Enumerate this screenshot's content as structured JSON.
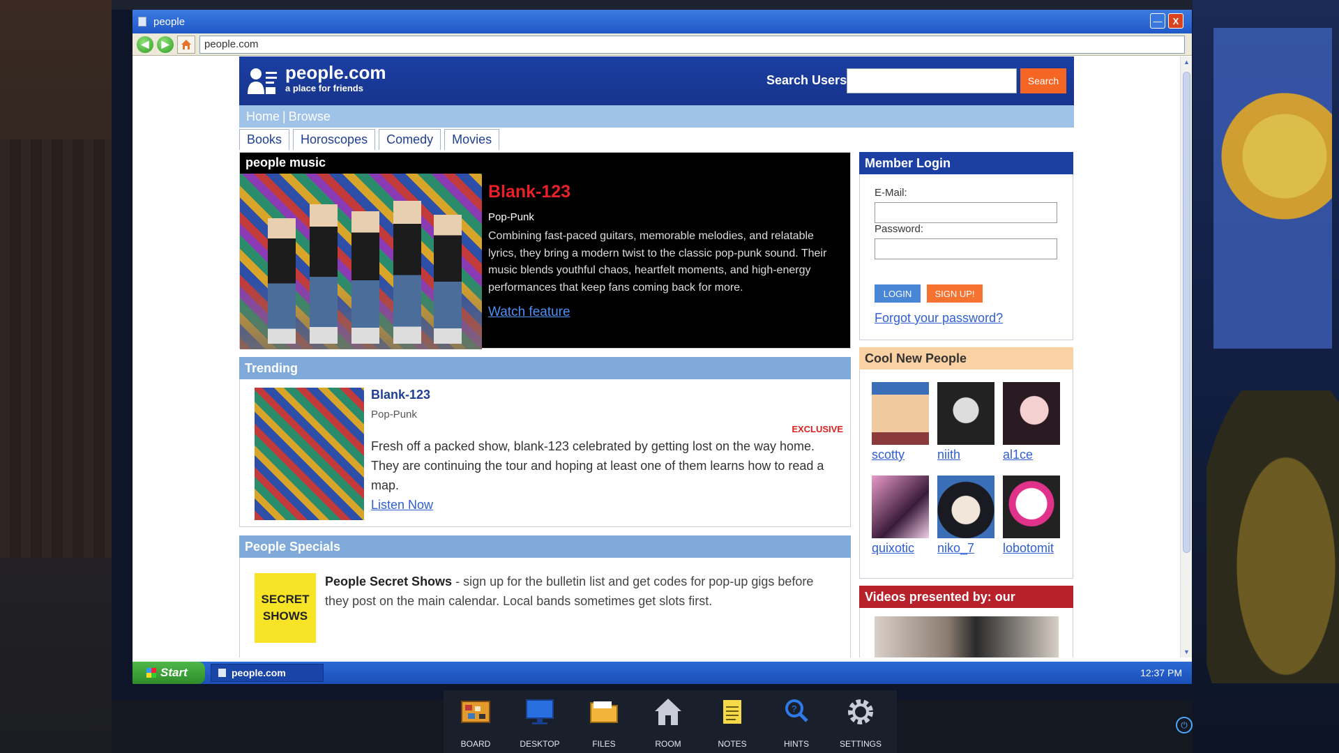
{
  "window": {
    "title": "people",
    "min_label": "—",
    "close_label": "X"
  },
  "address": {
    "url": "people.com",
    "back": "◀",
    "forward": "▶"
  },
  "site": {
    "logo_title": "people.com",
    "logo_sub": "a place for friends",
    "search_label": "Search Users:",
    "search_value": "",
    "search_button": "Search",
    "nav": {
      "home": "Home",
      "sep": "|",
      "browse": "Browse"
    },
    "tabs": [
      "Books",
      "Horoscopes",
      "Comedy",
      "Movies"
    ],
    "feature": {
      "section_title": "people music",
      "band": "Blank-123",
      "genre": "Pop-Punk",
      "description": "Combining fast-paced guitars, memorable melodies, and relatable lyrics, they bring a modern twist to the classic pop-punk sound. Their music blends youthful chaos, heartfelt moments, and high-energy performances that keep fans coming back for more.",
      "link": "Watch feature"
    },
    "trending": {
      "title": "Trending",
      "band": "Blank-123",
      "genre": "Pop-Punk",
      "badge": "EXCLUSIVE",
      "text": "Fresh off a packed show, blank-123 celebrated by getting lost on the way home. They are continuing the tour and hoping at least one of them learns how to read a map.",
      "link": "Listen Now"
    },
    "specials": {
      "title": "People Specials",
      "badge": "SECRET SHOWS",
      "headline": "People Secret Shows",
      "text": " - sign up for the bulletin list and get codes for pop-up gigs before they post on the main calendar. Local bands sometimes get slots first."
    },
    "login": {
      "title": "Member Login",
      "email_label": "E-Mail:",
      "password_label": "Password:",
      "login_button": "LOGIN",
      "signup_button": "SIGN UP!",
      "forgot": "Forgot your password?"
    },
    "cool_people": {
      "title": "Cool New People",
      "people": [
        "scotty",
        "niith",
        "al1ce",
        "quixotic",
        "niko_7",
        "lobotomit"
      ]
    },
    "videos": {
      "title": "Videos presented by: our sponsors"
    }
  },
  "taskbar": {
    "start": "Start",
    "item": "people.com",
    "clock": "12:37 PM"
  },
  "dock": [
    {
      "label": "BOARD",
      "icon": "board-icon"
    },
    {
      "label": "DESKTOP",
      "icon": "desktop-icon"
    },
    {
      "label": "FILES",
      "icon": "files-icon"
    },
    {
      "label": "ROOM",
      "icon": "room-icon"
    },
    {
      "label": "NOTES",
      "icon": "notes-icon"
    },
    {
      "label": "HINTS",
      "icon": "hints-icon"
    },
    {
      "label": "SETTINGS",
      "icon": "settings-icon"
    }
  ],
  "colors": {
    "header": "#1b3fa3",
    "accent": "#f56524",
    "link": "#2f5fd0",
    "nav": "#9fc2e8"
  }
}
